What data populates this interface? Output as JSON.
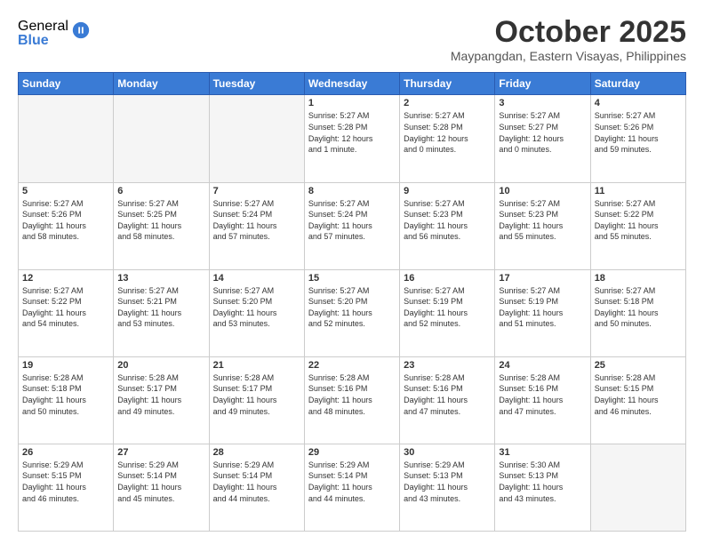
{
  "logo": {
    "general": "General",
    "blue": "Blue"
  },
  "header": {
    "month": "October 2025",
    "location": "Maypangdan, Eastern Visayas, Philippines"
  },
  "weekdays": [
    "Sunday",
    "Monday",
    "Tuesday",
    "Wednesday",
    "Thursday",
    "Friday",
    "Saturday"
  ],
  "weeks": [
    [
      {
        "day": "",
        "info": ""
      },
      {
        "day": "",
        "info": ""
      },
      {
        "day": "",
        "info": ""
      },
      {
        "day": "1",
        "info": "Sunrise: 5:27 AM\nSunset: 5:28 PM\nDaylight: 12 hours\nand 1 minute."
      },
      {
        "day": "2",
        "info": "Sunrise: 5:27 AM\nSunset: 5:28 PM\nDaylight: 12 hours\nand 0 minutes."
      },
      {
        "day": "3",
        "info": "Sunrise: 5:27 AM\nSunset: 5:27 PM\nDaylight: 12 hours\nand 0 minutes."
      },
      {
        "day": "4",
        "info": "Sunrise: 5:27 AM\nSunset: 5:26 PM\nDaylight: 11 hours\nand 59 minutes."
      }
    ],
    [
      {
        "day": "5",
        "info": "Sunrise: 5:27 AM\nSunset: 5:26 PM\nDaylight: 11 hours\nand 58 minutes."
      },
      {
        "day": "6",
        "info": "Sunrise: 5:27 AM\nSunset: 5:25 PM\nDaylight: 11 hours\nand 58 minutes."
      },
      {
        "day": "7",
        "info": "Sunrise: 5:27 AM\nSunset: 5:24 PM\nDaylight: 11 hours\nand 57 minutes."
      },
      {
        "day": "8",
        "info": "Sunrise: 5:27 AM\nSunset: 5:24 PM\nDaylight: 11 hours\nand 57 minutes."
      },
      {
        "day": "9",
        "info": "Sunrise: 5:27 AM\nSunset: 5:23 PM\nDaylight: 11 hours\nand 56 minutes."
      },
      {
        "day": "10",
        "info": "Sunrise: 5:27 AM\nSunset: 5:23 PM\nDaylight: 11 hours\nand 55 minutes."
      },
      {
        "day": "11",
        "info": "Sunrise: 5:27 AM\nSunset: 5:22 PM\nDaylight: 11 hours\nand 55 minutes."
      }
    ],
    [
      {
        "day": "12",
        "info": "Sunrise: 5:27 AM\nSunset: 5:22 PM\nDaylight: 11 hours\nand 54 minutes."
      },
      {
        "day": "13",
        "info": "Sunrise: 5:27 AM\nSunset: 5:21 PM\nDaylight: 11 hours\nand 53 minutes."
      },
      {
        "day": "14",
        "info": "Sunrise: 5:27 AM\nSunset: 5:20 PM\nDaylight: 11 hours\nand 53 minutes."
      },
      {
        "day": "15",
        "info": "Sunrise: 5:27 AM\nSunset: 5:20 PM\nDaylight: 11 hours\nand 52 minutes."
      },
      {
        "day": "16",
        "info": "Sunrise: 5:27 AM\nSunset: 5:19 PM\nDaylight: 11 hours\nand 52 minutes."
      },
      {
        "day": "17",
        "info": "Sunrise: 5:27 AM\nSunset: 5:19 PM\nDaylight: 11 hours\nand 51 minutes."
      },
      {
        "day": "18",
        "info": "Sunrise: 5:27 AM\nSunset: 5:18 PM\nDaylight: 11 hours\nand 50 minutes."
      }
    ],
    [
      {
        "day": "19",
        "info": "Sunrise: 5:28 AM\nSunset: 5:18 PM\nDaylight: 11 hours\nand 50 minutes."
      },
      {
        "day": "20",
        "info": "Sunrise: 5:28 AM\nSunset: 5:17 PM\nDaylight: 11 hours\nand 49 minutes."
      },
      {
        "day": "21",
        "info": "Sunrise: 5:28 AM\nSunset: 5:17 PM\nDaylight: 11 hours\nand 49 minutes."
      },
      {
        "day": "22",
        "info": "Sunrise: 5:28 AM\nSunset: 5:16 PM\nDaylight: 11 hours\nand 48 minutes."
      },
      {
        "day": "23",
        "info": "Sunrise: 5:28 AM\nSunset: 5:16 PM\nDaylight: 11 hours\nand 47 minutes."
      },
      {
        "day": "24",
        "info": "Sunrise: 5:28 AM\nSunset: 5:16 PM\nDaylight: 11 hours\nand 47 minutes."
      },
      {
        "day": "25",
        "info": "Sunrise: 5:28 AM\nSunset: 5:15 PM\nDaylight: 11 hours\nand 46 minutes."
      }
    ],
    [
      {
        "day": "26",
        "info": "Sunrise: 5:29 AM\nSunset: 5:15 PM\nDaylight: 11 hours\nand 46 minutes."
      },
      {
        "day": "27",
        "info": "Sunrise: 5:29 AM\nSunset: 5:14 PM\nDaylight: 11 hours\nand 45 minutes."
      },
      {
        "day": "28",
        "info": "Sunrise: 5:29 AM\nSunset: 5:14 PM\nDaylight: 11 hours\nand 44 minutes."
      },
      {
        "day": "29",
        "info": "Sunrise: 5:29 AM\nSunset: 5:14 PM\nDaylight: 11 hours\nand 44 minutes."
      },
      {
        "day": "30",
        "info": "Sunrise: 5:29 AM\nSunset: 5:13 PM\nDaylight: 11 hours\nand 43 minutes."
      },
      {
        "day": "31",
        "info": "Sunrise: 5:30 AM\nSunset: 5:13 PM\nDaylight: 11 hours\nand 43 minutes."
      },
      {
        "day": "",
        "info": ""
      }
    ]
  ]
}
